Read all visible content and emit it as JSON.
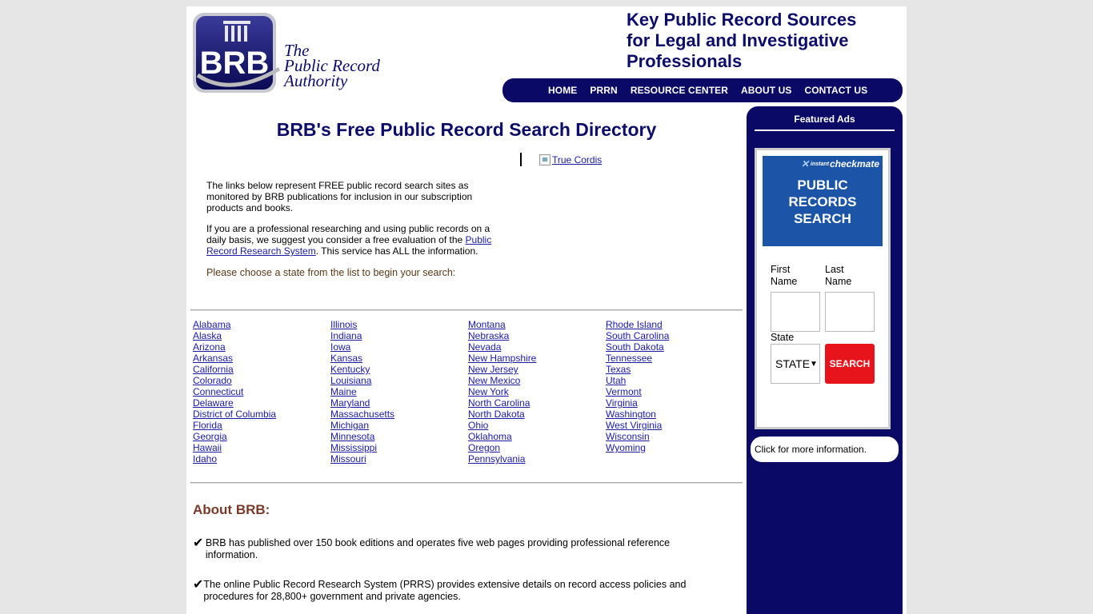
{
  "header": {
    "logo": {
      "letters": "BRB",
      "line1": "The",
      "line2": "Public Record",
      "line3": "Authority"
    },
    "tagline": [
      "Key Public Record Sources",
      "for Legal and Investigative",
      "Professionals"
    ],
    "nav": [
      "HOME",
      "PRRN",
      "RESOURCE CENTER",
      "ABOUT US",
      "CONTACT US"
    ]
  },
  "main": {
    "title": "BRB's Free Public Record Search Directory",
    "ad_link_text": "True Cordis",
    "intro_p1": "The links below represent FREE public record search sites as monitored by BRB publications for inclusion in our subscription products and books.",
    "intro_p2_pre": "If you are a professional researching and using public records on a daily basis, we suggest you consider a free evaluation of the ",
    "intro_p2_link": "Public Record Research System",
    "intro_p2_post": ". This service has ALL the information.",
    "choose_text": "Please choose a state from the list to begin your search:",
    "states": [
      [
        "Alabama",
        "Alaska",
        "Arizona",
        "Arkansas",
        "California",
        "Colorado",
        "Connecticut",
        "Delaware",
        "District of Columbia",
        "Florida",
        "Georgia",
        "Hawaii",
        "Idaho"
      ],
      [
        "Illinois",
        "Indiana",
        "Iowa",
        "Kansas",
        "Kentucky",
        "Louisiana",
        "Maine",
        "Maryland",
        "Massachusetts",
        "Michigan",
        "Minnesota",
        "Mississippi",
        "Missouri"
      ],
      [
        "Montana",
        "Nebraska",
        "Nevada",
        "New Hampshire",
        "New Jersey",
        "New Mexico",
        "New York",
        "North Carolina",
        "North Dakota",
        "Ohio",
        "Oklahoma",
        "Oregon",
        "Pennsylvania"
      ],
      [
        "Rhode Island",
        "South Carolina",
        "South Dakota",
        "Tennessee",
        "Texas",
        "Utah",
        "Vermont",
        "Virginia",
        "Washington",
        "West Virginia",
        "Wisconsin",
        "Wyoming"
      ]
    ],
    "about_title": "About BRB:",
    "bullet_mark": "✔",
    "bullets": [
      "BRB has published over 150 book editions and operates five web pages providing professional reference information.",
      "The online Public Record Research System (PRRS) provides extensive details on record access policies and procedures for 28,800+ government and private agencies."
    ]
  },
  "sidebar": {
    "featured_title": "Featured Ads",
    "ad": {
      "brand_small": "instant",
      "brand": "checkmate",
      "headline": [
        "PUBLIC",
        "RECORDS",
        "SEARCH"
      ],
      "first_name_label": "First Name",
      "last_name_label": "Last Name",
      "state_label": "State",
      "state_value": "STATE",
      "search_label": "SEARCH"
    },
    "more_info": "Click for more information."
  },
  "colors": {
    "navy": "#0a0a66",
    "title_navy": "#0c0c6a",
    "link": "#1a1aa6",
    "about_brown": "#7a3a2a",
    "ad_blue": "#1c55a8",
    "search_red": "#e8141c",
    "page_bg": "#e6e6e6"
  }
}
